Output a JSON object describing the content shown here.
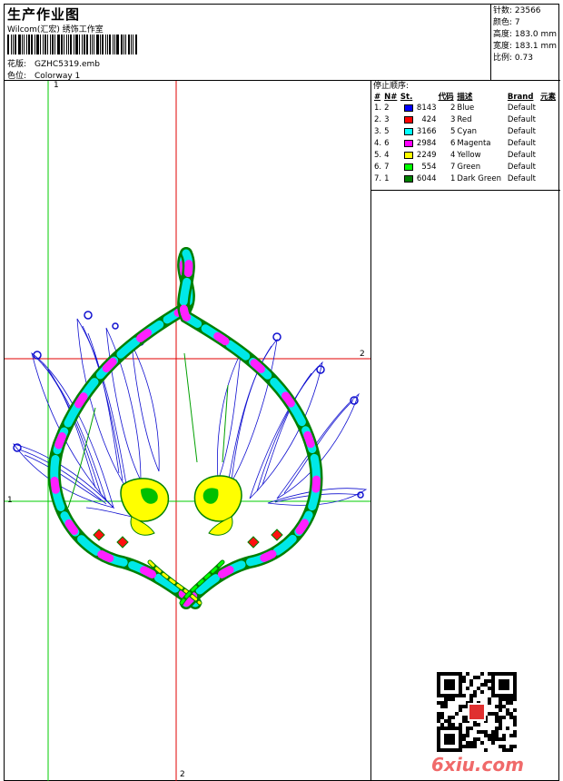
{
  "header": {
    "title": "生产作业图",
    "company": "Wilcom(汇宏) 绣饰工作室",
    "design_label": "花版:",
    "design_value": "GZHC5319.emb",
    "colorway_label": "色位:",
    "colorway_value": "Colorway 1"
  },
  "stats": {
    "stitches": "针数: 23566",
    "colors": "颜色: 7",
    "height": "高度: 183.0 mm",
    "width": "宽度: 183.1 mm",
    "scale": "比例: 0.73"
  },
  "sequence": {
    "title": "停止顺序:",
    "headers": [
      "#",
      "N#",
      "St.",
      "代码",
      "描述",
      "Brand",
      "元素"
    ],
    "rows": [
      {
        "idx": "1.",
        "n": "2",
        "color": "#0000ff",
        "st": "8143",
        "code": "2",
        "desc": "Blue",
        "brand": "Default"
      },
      {
        "idx": "2.",
        "n": "3",
        "color": "#ff0000",
        "st": "424",
        "code": "3",
        "desc": "Red",
        "brand": "Default"
      },
      {
        "idx": "3.",
        "n": "5",
        "color": "#00ffff",
        "st": "3166",
        "code": "5",
        "desc": "Cyan",
        "brand": "Default"
      },
      {
        "idx": "4.",
        "n": "6",
        "color": "#ff00ff",
        "st": "2984",
        "code": "6",
        "desc": "Magenta",
        "brand": "Default"
      },
      {
        "idx": "5.",
        "n": "4",
        "color": "#ffff00",
        "st": "2249",
        "code": "4",
        "desc": "Yellow",
        "brand": "Default"
      },
      {
        "idx": "6.",
        "n": "7",
        "color": "#00ff00",
        "st": "554",
        "code": "7",
        "desc": "Green",
        "brand": "Default"
      },
      {
        "idx": "7.",
        "n": "1",
        "color": "#008000",
        "st": "6044",
        "code": "1",
        "desc": "Dark Green",
        "brand": "Default"
      }
    ]
  },
  "guides": {
    "green_top": "1",
    "green_left": "1",
    "red_right": "2",
    "red_bottom": "2"
  },
  "watermark": {
    "brand": "6xiu.com"
  }
}
